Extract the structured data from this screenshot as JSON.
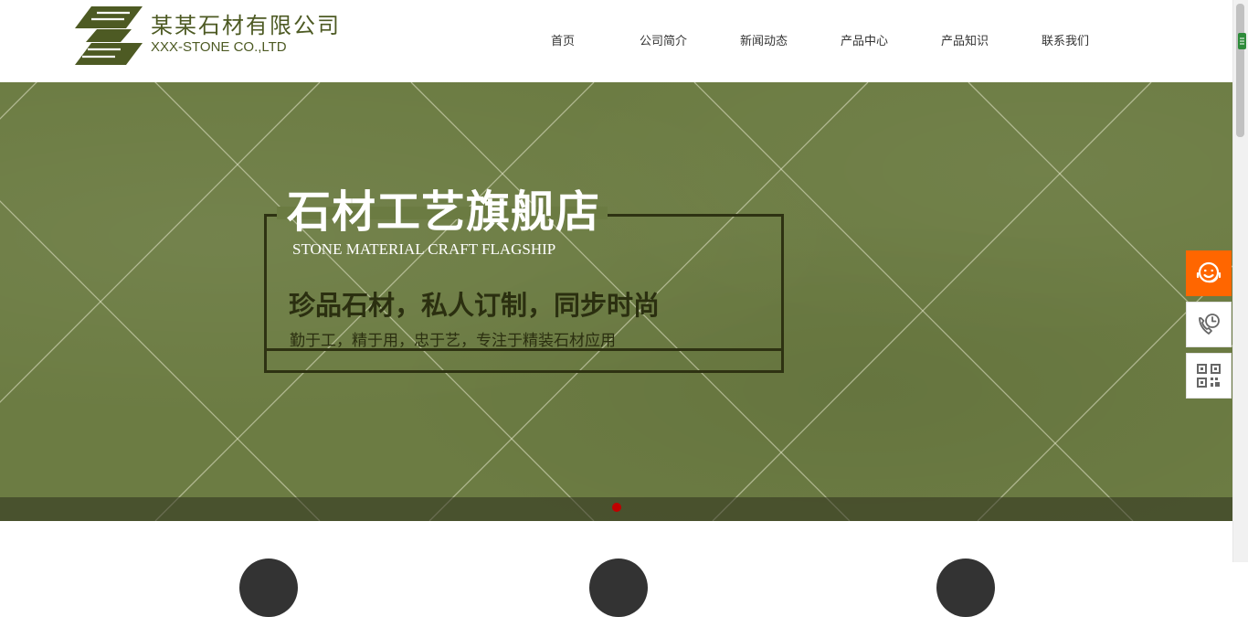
{
  "header": {
    "company_name": "某某石材有限公司",
    "company_name_en": "XXX-STONE CO.,LTD",
    "nav": [
      {
        "label": "首页"
      },
      {
        "label": "公司简介"
      },
      {
        "label": "新闻动态"
      },
      {
        "label": "产品中心"
      },
      {
        "label": "产品知识"
      },
      {
        "label": "联系我们"
      }
    ]
  },
  "banner": {
    "title": "石材工艺旗舰店",
    "subtitle_en": "STONE MATERIAL CRAFT FLAGSHIP",
    "slogan": "珍品石材，私人订制，同步时尚",
    "description": "勤于工，精于用，忠于艺，专注于精装石材应用",
    "slide_count": 1,
    "active_slide": 1
  },
  "side_float": {
    "buttons": [
      "customer-service-icon",
      "phone-icon",
      "qr-code-icon"
    ]
  },
  "colors": {
    "brand": "#4d5a23",
    "banner_bg": "#6c7c43",
    "frame": "#2e3212",
    "accent": "#ff6600",
    "pager_active": "#c00000"
  }
}
